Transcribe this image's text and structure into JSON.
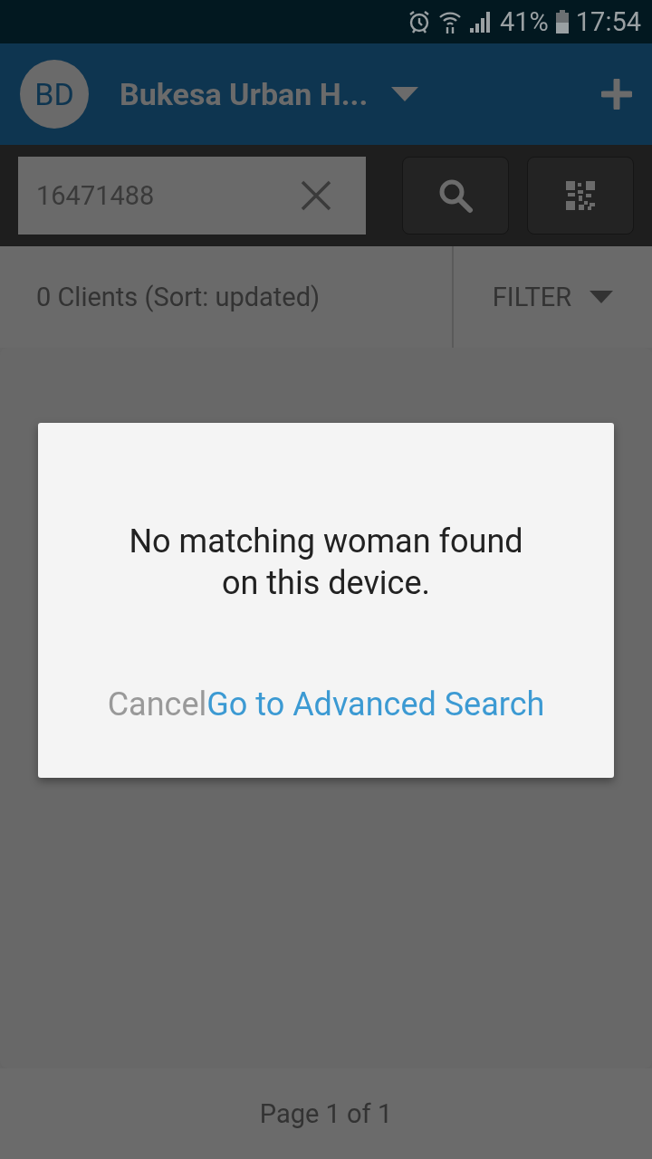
{
  "status_bar": {
    "battery": "41%",
    "time": "17:54"
  },
  "app_bar": {
    "avatar": "BD",
    "title": "Bukesa Urban H..."
  },
  "search": {
    "value": "16471488"
  },
  "list_header": {
    "count": "0 Clients (Sort: updated)",
    "filter": "FILTER"
  },
  "footer": {
    "page": "Page 1 of 1"
  },
  "dialog": {
    "message": "No matching woman found on this device.",
    "buttons": [
      {
        "label": "Cancel",
        "kind": "secondary"
      },
      {
        "label": "Go to Advanced Search",
        "kind": "primary"
      }
    ]
  }
}
